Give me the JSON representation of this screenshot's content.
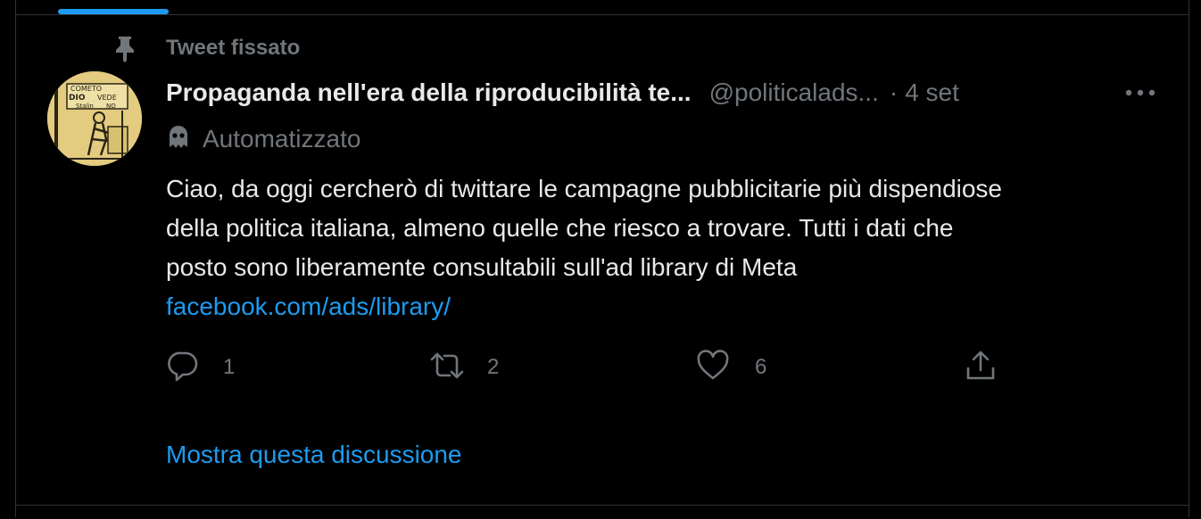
{
  "pinned": {
    "label": "Tweet fissato",
    "icon": "pin-icon"
  },
  "tweet": {
    "display_name": "Propaganda nell'era della riproducibilità te...",
    "handle": "@politicalads...",
    "separator": "·",
    "timestamp": "4 set",
    "automated_label": "Automatizzato",
    "automated_icon": "robot-icon",
    "avatar_text": [
      "COMETO",
      "DIO",
      "VEDE",
      "Stalin",
      "NO"
    ],
    "text_lines": [
      "Ciao, da oggi cercherò di twittare le campagne pubblicitarie più dispendiose",
      "della politica italiana, almeno quelle che riesco a trovare. Tutti i dati che",
      "posto sono liberamente consultabili sull'ad library di Meta"
    ],
    "link": "facebook.com/ads/library/"
  },
  "actions": {
    "reply": {
      "icon": "reply-icon",
      "count": "1"
    },
    "retweet": {
      "icon": "retweet-icon",
      "count": "2"
    },
    "like": {
      "icon": "heart-icon",
      "count": "6"
    },
    "share": {
      "icon": "share-icon"
    }
  },
  "show_thread": "Mostra questa discussione",
  "colors": {
    "background": "#000000",
    "text_primary": "#e7e9ea",
    "text_secondary": "#71767b",
    "accent": "#1d9bf0",
    "border": "#2f3336"
  }
}
